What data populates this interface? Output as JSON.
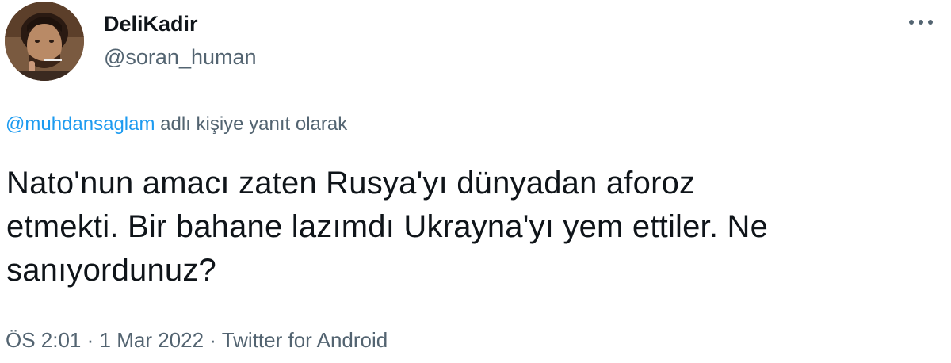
{
  "user": {
    "display_name": "DeliKadir",
    "handle": "@soran_human"
  },
  "reply": {
    "mention": "@muhdansaglam",
    "suffix": " adlı kişiye yanıt olarak"
  },
  "tweet": {
    "lines": [
      "Nato'nun amacı zaten Rusya'yı dünyadan aforoz",
      "etmekti. Bir bahane lazımdı Ukrayna'yı yem ettiler. Ne",
      "sanıyordunuz?"
    ]
  },
  "meta": {
    "time": "ÖS 2:01",
    "separator": " · ",
    "date": "1 Mar 2022",
    "source": "Twitter for Android"
  },
  "icons": {
    "more": "more-horizontal-icon",
    "avatar": "user-avatar"
  },
  "colors": {
    "primary_text": "#0f1419",
    "secondary_text": "#536471",
    "link": "#1d9bf0",
    "background": "#ffffff"
  }
}
